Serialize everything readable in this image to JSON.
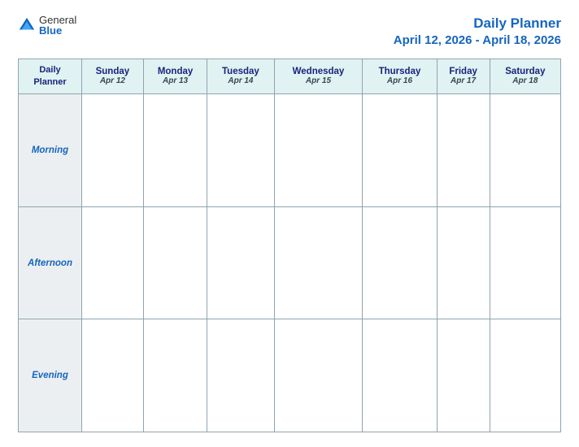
{
  "logo": {
    "general": "General",
    "blue": "Blue",
    "icon": "▶"
  },
  "header": {
    "title": "Daily Planner",
    "date_range": "April 12, 2026 - April 18, 2026"
  },
  "table": {
    "label_header_line1": "Daily",
    "label_header_line2": "Planner",
    "days": [
      {
        "name": "Sunday",
        "date": "Apr 12"
      },
      {
        "name": "Monday",
        "date": "Apr 13"
      },
      {
        "name": "Tuesday",
        "date": "Apr 14"
      },
      {
        "name": "Wednesday",
        "date": "Apr 15"
      },
      {
        "name": "Thursday",
        "date": "Apr 16"
      },
      {
        "name": "Friday",
        "date": "Apr 17"
      },
      {
        "name": "Saturday",
        "date": "Apr 18"
      }
    ],
    "time_slots": [
      "Morning",
      "Afternoon",
      "Evening"
    ]
  }
}
